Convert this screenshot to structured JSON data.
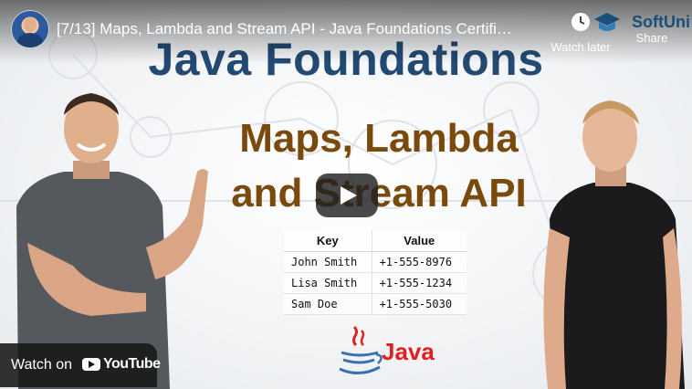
{
  "player": {
    "video_title": "[7/13] Maps, Lambda and Stream API - Java Foundations Certifi…",
    "watch_later_label": "Watch later",
    "share_label": "Share",
    "logo_text": "SoftUni",
    "watch_on_label": "Watch on",
    "youtube_label": "YouTube"
  },
  "slide": {
    "title": "Java Foundations",
    "subtitle_line1": "Maps, Lambda",
    "subtitle_line2": "and Stream API",
    "table": {
      "headers": [
        "Key",
        "Value"
      ],
      "rows": [
        [
          "John Smith",
          "+1-555-8976"
        ],
        [
          "Lisa Smith",
          "+1-555-1234"
        ],
        [
          "Sam Doe",
          "+1-555-5030"
        ]
      ]
    },
    "java_label": "Java"
  },
  "icons": {
    "watch_later": "clock-icon",
    "share": "share-icon",
    "play": "play-icon",
    "youtube": "youtube-logo-icon",
    "java": "java-cup-icon"
  },
  "colors": {
    "title": "#234a73",
    "subtitle": "#7a4a0c",
    "java_red": "#e02020",
    "play_bg": "#212121"
  }
}
